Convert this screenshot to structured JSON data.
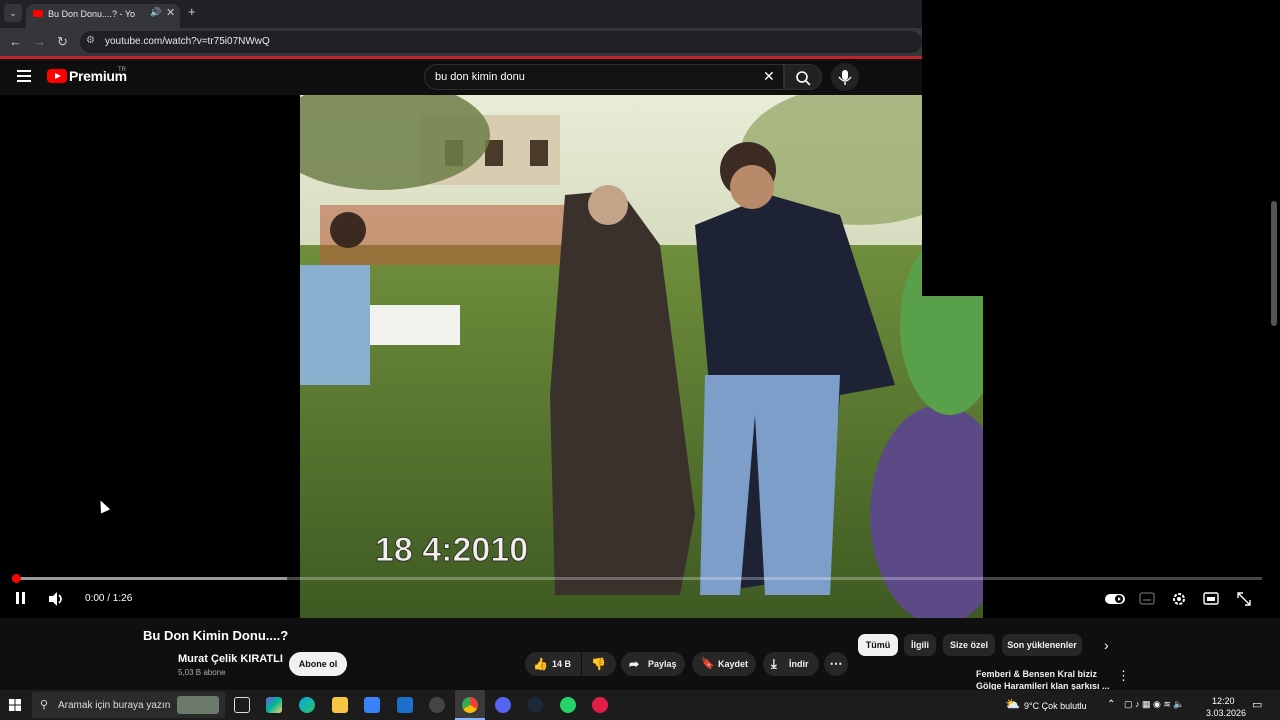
{
  "browser": {
    "tab_title": "Bu Don Donu....? - Yo",
    "url": "youtube.com/watch?v=tr75i07NWwQ"
  },
  "header": {
    "logo_text": "Premium",
    "region": "TR",
    "search_query": "bu don kimin donu"
  },
  "video": {
    "date_stamp": "18  4:2010",
    "current_time": "0:00",
    "duration": "1:26",
    "time_display": "0:00 / 1:26",
    "progress_fraction": 0.0,
    "buffered_fraction": 0.22
  },
  "watch": {
    "title": "Bu Don Kimin Donu....?",
    "channel": "Murat Çelik KIRATLI",
    "subscribers": "5,03 B abone",
    "subscribe_label": "Abone ol",
    "likes": "14 B",
    "share_label": "Paylaş",
    "save_label": "Kaydet",
    "download_label": "İndir"
  },
  "chips": [
    "Tümü",
    "İlgili",
    "Size özel",
    "Son yüklenenler"
  ],
  "recommendation": {
    "title_line1": "Femberi & Bensen Kral biziz",
    "title_line2": "Gölge Haramileri klan şarkısı ..."
  },
  "taskbar": {
    "search_placeholder": "Aramak için buraya yazın",
    "weather": "9°C  Çok bulutlu",
    "time": "12:20",
    "date": "3.03.2026"
  },
  "colors": {
    "accent_red": "#ff0000",
    "browser_line": "#c0252c",
    "background": "#0f0f0f"
  }
}
